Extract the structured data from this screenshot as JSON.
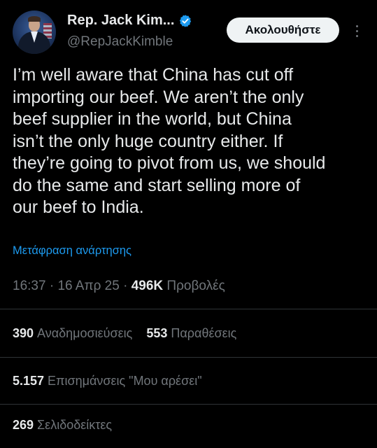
{
  "author": {
    "display_name": "Rep. Jack Kim...",
    "handle": "@RepJackKimble",
    "verified_icon": "verified-badge-icon",
    "verified_color": "#1d9bf0"
  },
  "header": {
    "follow_label": "Ακολουθήστε",
    "more_icon": "more-vertical-icon"
  },
  "tweet": {
    "text": "I’m well aware that China has cut off\nimporting our beef. We aren’t the only\nbeef supplier in the world, but China\nisn’t the only huge country either. If\nthey’re going to pivot from us, we should\ndo the same and start selling more of\nour beef to India.",
    "translate_label": "Μετάφραση ανάρτησης"
  },
  "meta": {
    "time": "16:37",
    "sep1": " · ",
    "date": "16 Απρ 25",
    "sep2": " · ",
    "views_count": "496K",
    "views_label": "Προβολές"
  },
  "stats": {
    "reposts": {
      "count": "390",
      "label": "Αναδημοσιεύσεις"
    },
    "quotes": {
      "count": "553",
      "label": "Παραθέσεις"
    },
    "likes": {
      "count": "5.157",
      "label": "Επισημάνσεις \"Μου αρέσει\""
    },
    "bookmarks": {
      "count": "269",
      "label": "Σελιδοδείκτες"
    }
  },
  "colors": {
    "background": "#000000",
    "text_primary": "#e7e9ea",
    "text_secondary": "#71767b",
    "accent": "#1d9bf0",
    "divider": "#2f3336",
    "follow_button_bg": "#eff3f4"
  }
}
